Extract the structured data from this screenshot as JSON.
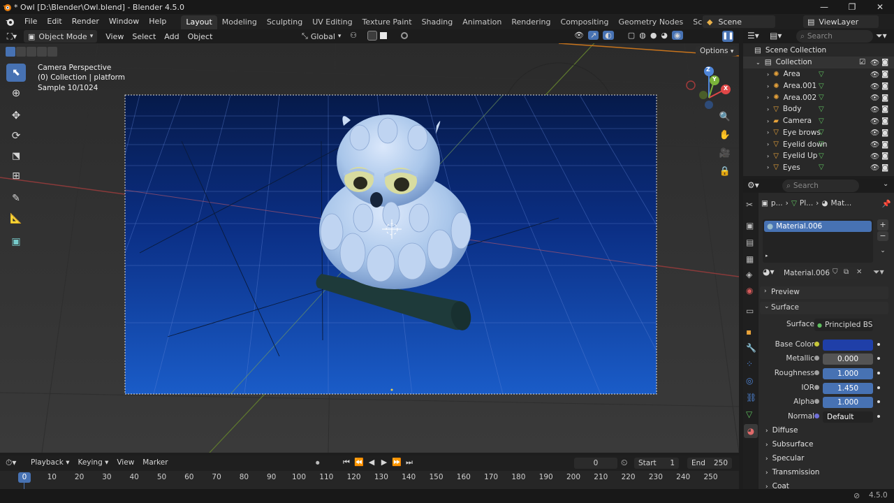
{
  "window": {
    "title": "* Owl [D:\\Blender\\Owl.blend] - Blender 4.5.0",
    "controls": [
      "—",
      "❐",
      "✕"
    ]
  },
  "menu": {
    "items": [
      "File",
      "Edit",
      "Render",
      "Window",
      "Help"
    ],
    "workspaces": [
      "Layout",
      "Modeling",
      "Sculpting",
      "UV Editing",
      "Texture Paint",
      "Shading",
      "Animation",
      "Rendering",
      "Compositing",
      "Geometry Nodes",
      "Scripting"
    ],
    "active_workspace": "Layout",
    "add_tab": "+",
    "scene": "Scene",
    "view_layer": "ViewLayer"
  },
  "viewport": {
    "mode": "Object Mode",
    "menus": [
      "View",
      "Select",
      "Add",
      "Object"
    ],
    "orientation": "Global",
    "options": "Options",
    "info": [
      "Camera Perspective",
      "(0) Collection | platform",
      "Sample 10/1024"
    ],
    "gizmo": {
      "x": "X",
      "y": "Y",
      "z": "Z"
    },
    "colors": {
      "render_top": "#061a4a",
      "render_bottom": "#1a5cc8",
      "owl": "#a9c6ea",
      "branch": "#1e3a3a"
    }
  },
  "outliner": {
    "search_placeholder": "Search",
    "root": "Scene Collection",
    "collection": "Collection",
    "items": [
      {
        "name": "Area",
        "icon": "light-icon"
      },
      {
        "name": "Area.001",
        "icon": "light-icon"
      },
      {
        "name": "Area.002",
        "icon": "light-icon"
      },
      {
        "name": "Body",
        "icon": "mesh-icon"
      },
      {
        "name": "Camera",
        "icon": "camera-icon"
      },
      {
        "name": "Eye brows",
        "icon": "mesh-icon"
      },
      {
        "name": "Eyelid down",
        "icon": "mesh-icon"
      },
      {
        "name": "Eyelid Up",
        "icon": "mesh-icon"
      },
      {
        "name": "Eyes",
        "icon": "mesh-icon"
      }
    ]
  },
  "properties": {
    "search_placeholder": "Search",
    "breadcrumb": [
      "p...",
      "Pl...",
      "Mat..."
    ],
    "slot": "Material.006",
    "material_name": "Material.006",
    "panels": {
      "preview": "Preview",
      "surface": "Surface"
    },
    "surface": "Principled BSDF",
    "fields": [
      {
        "label": "Base Color",
        "value": "",
        "color": "#1f3fa8"
      },
      {
        "label": "Metallic",
        "value": "0.000"
      },
      {
        "label": "Roughness",
        "value": "1.000"
      },
      {
        "label": "IOR",
        "value": "1.450"
      },
      {
        "label": "Alpha",
        "value": "1.000"
      },
      {
        "label": "Normal",
        "value": "Default"
      }
    ],
    "collapsed_panels": [
      "Diffuse",
      "Subsurface",
      "Specular",
      "Transmission",
      "Coat"
    ]
  },
  "timeline": {
    "menus": [
      "Playback",
      "Keying",
      "View",
      "Marker"
    ],
    "current_frame": "0",
    "start_label": "Start",
    "start": "1",
    "end_label": "End",
    "end": "250",
    "ticks": [
      "0",
      "10",
      "20",
      "30",
      "40",
      "50",
      "60",
      "70",
      "80",
      "90",
      "100",
      "110",
      "120",
      "130",
      "140",
      "150",
      "160",
      "170",
      "180",
      "190",
      "200",
      "210",
      "220",
      "230",
      "240",
      "250"
    ]
  },
  "status": {
    "version": "4.5.0"
  }
}
